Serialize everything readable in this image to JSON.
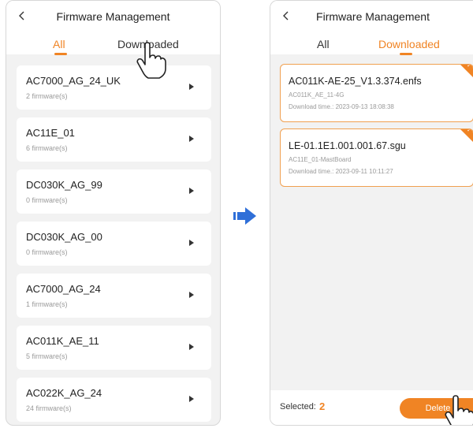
{
  "left_screen": {
    "title": "Firmware Management",
    "back_icon": "chevron-left-icon",
    "tabs": [
      {
        "label": "All",
        "active": true
      },
      {
        "label": "Downloaded",
        "active": false
      }
    ],
    "items": [
      {
        "name": "AC7000_AG_24_UK",
        "count": "2 firmware(s)"
      },
      {
        "name": "AC11E_01",
        "count": "6 firmware(s)"
      },
      {
        "name": "DC030K_AG_99",
        "count": "0 firmware(s)"
      },
      {
        "name": "DC030K_AG_00",
        "count": "0 firmware(s)"
      },
      {
        "name": "AC7000_AG_24",
        "count": "1 firmware(s)"
      },
      {
        "name": "AC011K_AE_11",
        "count": "5 firmware(s)"
      },
      {
        "name": "AC022K_AG_24",
        "count": "24 firmware(s)"
      }
    ]
  },
  "right_screen": {
    "title": "Firmware Management",
    "back_icon": "chevron-left-icon",
    "tabs": [
      {
        "label": "All",
        "active": false
      },
      {
        "label": "Downloaded",
        "active": true
      }
    ],
    "downloaded": [
      {
        "file": "AC011K-AE-25_V1.3.374.enfs",
        "model": "AC011K_AE_11-4G",
        "time": "Download time.: 2023-09-13 18:08:38",
        "selected": true
      },
      {
        "file": "LE-01.1E1.001.001.67.sgu",
        "model": "AC11E_01-MastBoard",
        "time": "Download time.: 2023-09-11 10:11:27",
        "selected": true
      }
    ],
    "footer": {
      "selected_label": "Selected:",
      "selected_count": "2",
      "delete_label": "Delete"
    }
  },
  "colors": {
    "accent": "#f08424",
    "background": "#f2f2f2",
    "card": "#ffffff",
    "transition_arrow": "#2f6fd8"
  }
}
